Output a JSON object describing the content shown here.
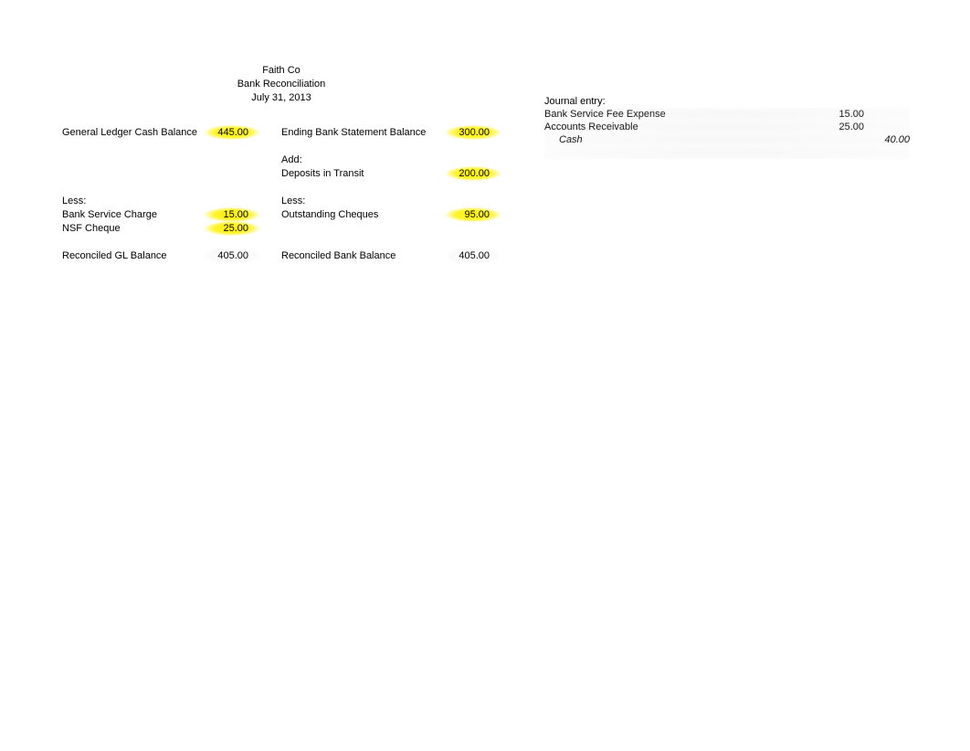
{
  "header": {
    "company": "Faith Co",
    "title": "Bank Reconciliation",
    "date": "July 31, 2013"
  },
  "gl_side": {
    "balance_label": "General Ledger Cash Balance",
    "balance_value": "445.00",
    "less_label": "Less:",
    "items": [
      {
        "label": "Bank Service Charge",
        "value": "15.00"
      },
      {
        "label": "NSF Cheque",
        "value": "25.00"
      }
    ],
    "reconciled_label": "Reconciled GL Balance",
    "reconciled_value": "405.00"
  },
  "bank_side": {
    "balance_label": "Ending Bank Statement Balance",
    "balance_value": "300.00",
    "add_label": "Add:",
    "add_items": [
      {
        "label": "Deposits in Transit",
        "value": "200.00"
      }
    ],
    "less_label": "Less:",
    "less_items": [
      {
        "label": "Outstanding Cheques",
        "value": "95.00"
      }
    ],
    "reconciled_label": "Reconciled Bank Balance",
    "reconciled_value": "405.00"
  },
  "journal": {
    "title": "Journal entry:",
    "lines": [
      {
        "account": "Bank Service Fee Expense",
        "debit": "15.00",
        "credit": ""
      },
      {
        "account": "Accounts Receivable",
        "debit": "25.00",
        "credit": ""
      },
      {
        "account": "Cash",
        "debit": "",
        "credit": "40.00",
        "italic": true,
        "indent": true
      }
    ]
  }
}
